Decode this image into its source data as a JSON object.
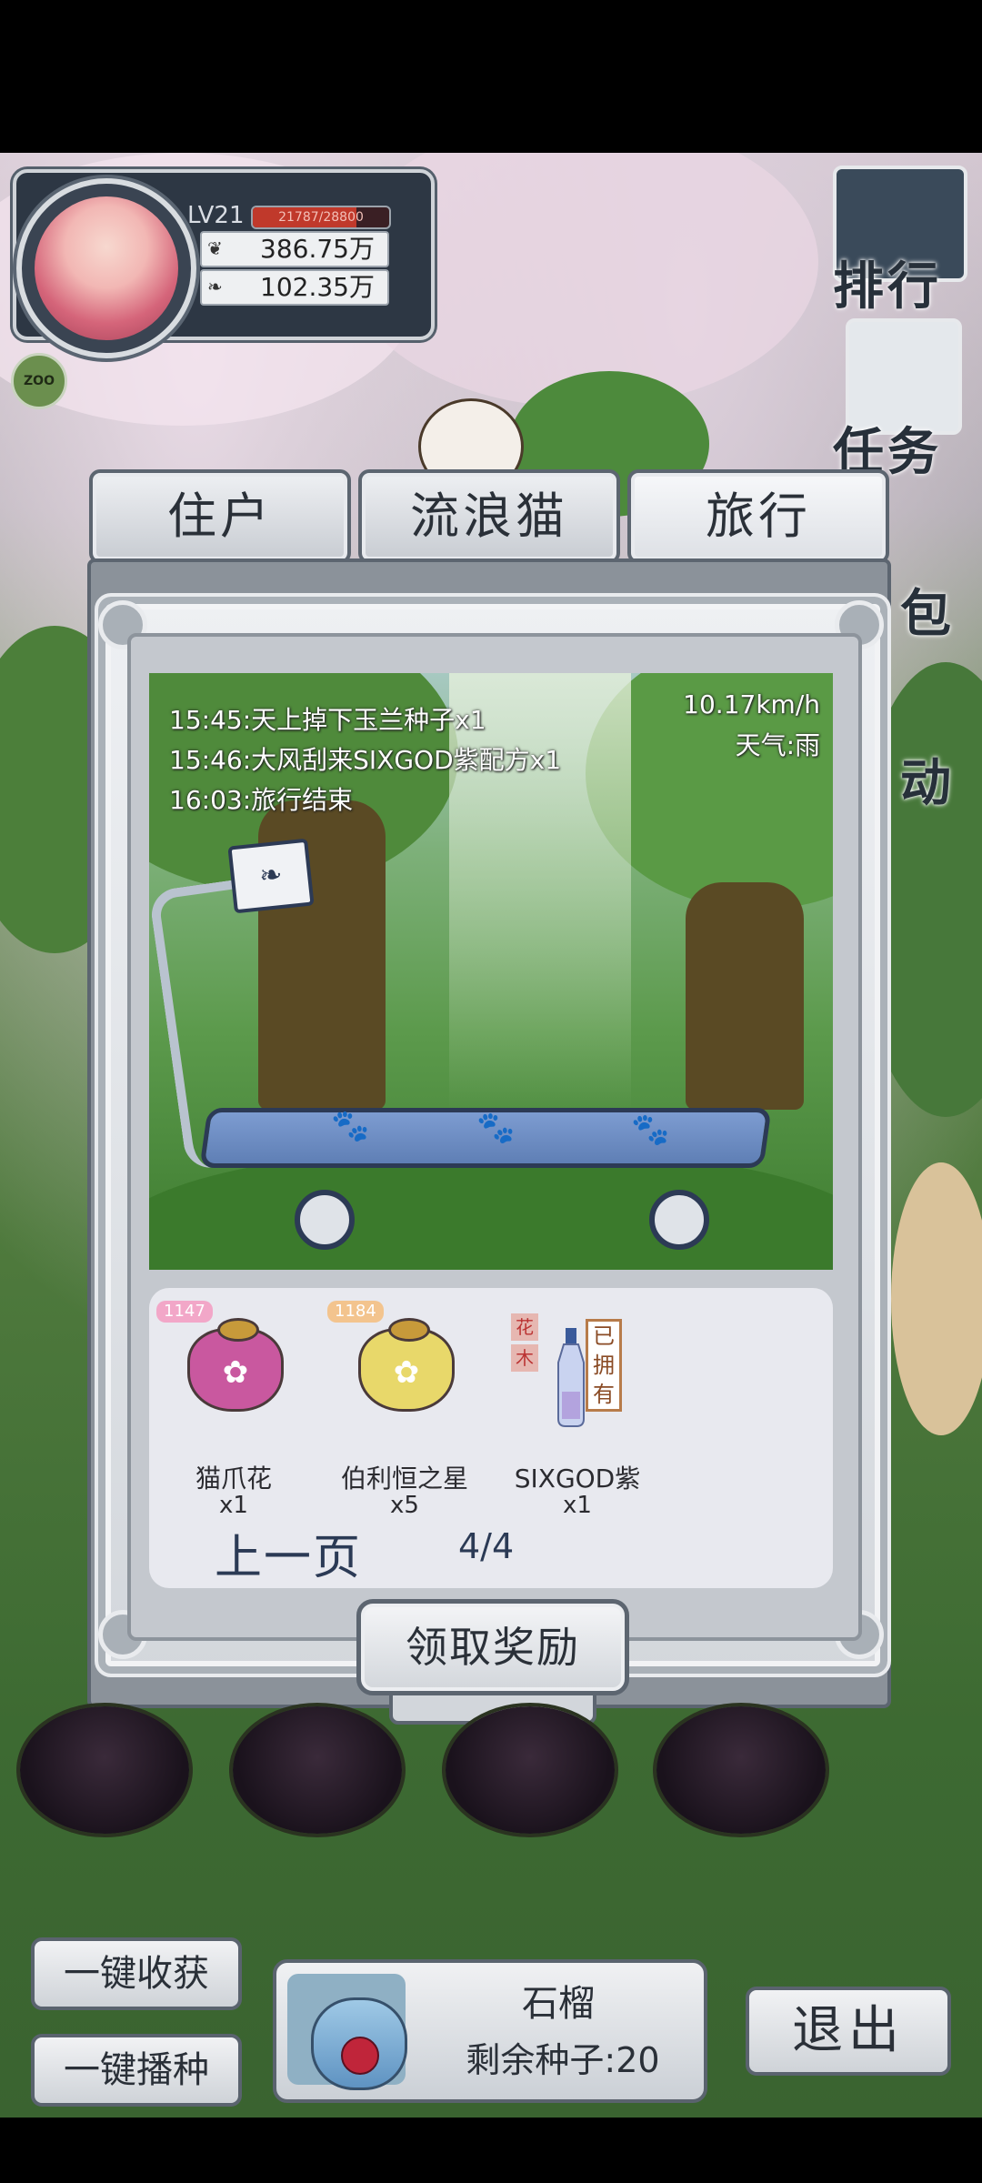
{
  "player": {
    "level": "LV21",
    "exp_text": "21787/28800",
    "exp_fraction": 0.757,
    "coins": "386.75万",
    "gems": "102.35万",
    "zoo_badge": "ZOO"
  },
  "side_menu": {
    "rank": "排行",
    "tasks": "任务",
    "bag": "包",
    "activity": "动"
  },
  "tabs": {
    "residents": "住户",
    "stray_cats": "流浪猫",
    "travel": "旅行"
  },
  "travel": {
    "logs": [
      "15:45:天上掉下玉兰种子x1",
      "15:46:大风刮来SIXGOD紫配方x1",
      "16:03:旅行结束"
    ],
    "speed": "10.17km/h",
    "weather": "天气:雨"
  },
  "rewards": {
    "items": [
      {
        "badge": "1147",
        "name": "猫爪花",
        "qty": "x1",
        "color": "#c9589f"
      },
      {
        "badge": "1184",
        "name": "伯利恒之星",
        "qty": "x5",
        "color": "#e8d86a"
      },
      {
        "badge": "",
        "name": "SIXGOD紫",
        "qty": "x1",
        "color": "#b7c3e6"
      }
    ],
    "flower_tags": [
      "花",
      "木"
    ],
    "owned_tag": "已拥有",
    "prev_page": "上一页",
    "page_indicator": "4/4",
    "claim_button": "领取奖励"
  },
  "bottom": {
    "harvest_all": "一键收获",
    "plant_all": "一键播种",
    "seed_name": "石榴",
    "seeds_left": "剩余种子:20",
    "exit": "退出"
  },
  "colors": {
    "panel_dark": "#2d3744",
    "frame_gray": "#8b929a",
    "reward_panel": "#e8e9ef",
    "exp_red": "#c0392b"
  }
}
